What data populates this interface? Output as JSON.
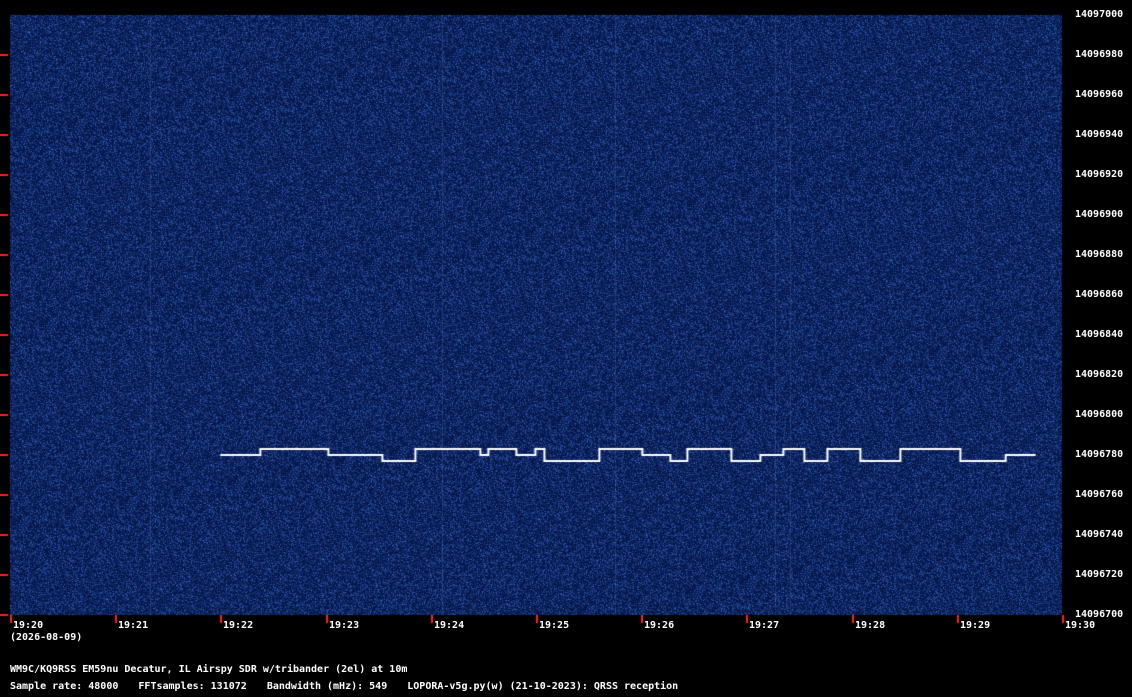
{
  "colors": {
    "background": "#000000",
    "waterfall": "#0b1f4d",
    "signal": "#ffffff",
    "tick": "#ff2020",
    "text": "#ffffff"
  },
  "chart_data": {
    "type": "heatmap",
    "title": "",
    "xlabel": "",
    "ylabel": "",
    "x_ticks": [
      "19:20",
      "19:21",
      "19:22",
      "19:23",
      "19:24",
      "19:25",
      "19:26",
      "19:27",
      "19:28",
      "19:29",
      "19:30"
    ],
    "x_date": "(2026-08-09)",
    "y_ticks": [
      14096700,
      14096720,
      14096740,
      14096760,
      14096780,
      14096800,
      14096820,
      14096840,
      14096860,
      14096880,
      14096900,
      14096920,
      14096940,
      14096960,
      14096980,
      14097000
    ],
    "ylim": [
      14096700,
      14097000
    ],
    "signal": {
      "description": "FSK/CW trace",
      "start_minute": 2.0,
      "end_minute": 9.75,
      "base_freq_hz": 14096780,
      "shift_hz": 3
    }
  },
  "info": {
    "station": "WM9C/KQ9RSS EM59nu Decatur, IL  Airspy SDR w/tribander (2el) at 10m",
    "sample_rate": "Sample rate: 48000",
    "fft_samples": "FFTsamples: 131072",
    "bandwidth": "Bandwidth (mHz): 549",
    "software": "LOPORA-v5g.py(w) (21-10-2023): QRSS reception"
  }
}
